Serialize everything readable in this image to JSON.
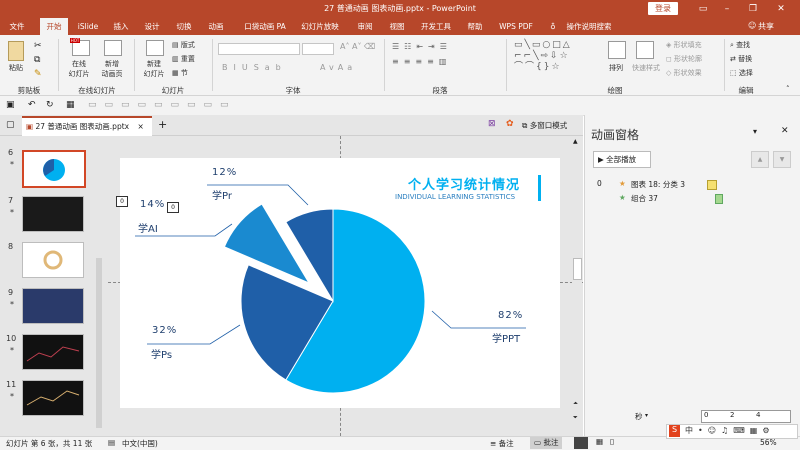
{
  "window": {
    "title": "27 普通动画 图表动画.pptx - PowerPoint",
    "login": "登录",
    "share": "共享"
  },
  "tabs": [
    "文件",
    "开始",
    "iSlide",
    "插入",
    "设计",
    "切换",
    "动画",
    "口袋动画 PA",
    "幻灯片放映",
    "审阅",
    "视图",
    "开发工具",
    "帮助",
    "WPS PDF",
    "操作说明搜索"
  ],
  "ribbon": {
    "paste": "粘贴",
    "online_slides": "在线\n幻灯片",
    "new_slide": "新建\n幻灯片",
    "new_animation_page": "新增\n动画页",
    "layout": "版式",
    "reset": "重置",
    "section": "节",
    "arrange": "排列",
    "quick_styles": "快速样式",
    "shape_fill": "形状填充",
    "shape_outline": "形状轮廓",
    "shape_effects": "形状效果",
    "find": "查找",
    "replace": "替换",
    "select": "选择",
    "groups": [
      "剪贴板",
      "在线幻灯片",
      "幻灯片",
      "字体",
      "段落",
      "绘图",
      "编辑"
    ]
  },
  "doc_tab": {
    "name": "27 普通动画 图表动画.pptx",
    "multi_window": "多窗口模式"
  },
  "thumbnails": [
    {
      "num": "6",
      "star": "*"
    },
    {
      "num": "7",
      "star": "*"
    },
    {
      "num": "8",
      "star": ""
    },
    {
      "num": "9",
      "star": "*"
    },
    {
      "num": "10",
      "star": "*"
    },
    {
      "num": "11",
      "star": "*"
    }
  ],
  "slide": {
    "title": "个人学习统计情况",
    "subtitle": "INDIVIDUAL LEARNING STATISTICS",
    "labels": [
      {
        "pct": "12%",
        "name": "学Pr"
      },
      {
        "pct": "14%",
        "name": "学AI"
      },
      {
        "pct": "32%",
        "name": "学Ps"
      },
      {
        "pct": "82%",
        "name": "学PPT"
      }
    ],
    "tag_0a": "0",
    "tag_0b": "0"
  },
  "chart_data": {
    "type": "pie",
    "categories": [
      "学PPT",
      "学Ps",
      "学AI",
      "学Pr"
    ],
    "values": [
      82,
      32,
      14,
      12
    ],
    "colors": [
      "#00b0f0",
      "#1f5fa8",
      "#1a8ad0",
      "#1f5fa8"
    ]
  },
  "anim_pane": {
    "title": "动画窗格",
    "play_all": "全部播放",
    "items": [
      {
        "index": "0",
        "label": "图表 18: 分类 3"
      },
      {
        "index": "",
        "label": "组合 37"
      }
    ],
    "seconds_label": "秒",
    "timeline": [
      "0",
      "2",
      "4"
    ]
  },
  "status": {
    "slide_info": "幻灯片 第 6 张，共 11 张",
    "language": "中文(中国)",
    "notes": "备注",
    "comments": "批注",
    "zoom": "56%"
  },
  "colors": {
    "accent": "#b7472a",
    "slide_title": "#00b0f0",
    "pie_light": "#00b0f0",
    "pie_dark": "#1f5fa8"
  }
}
